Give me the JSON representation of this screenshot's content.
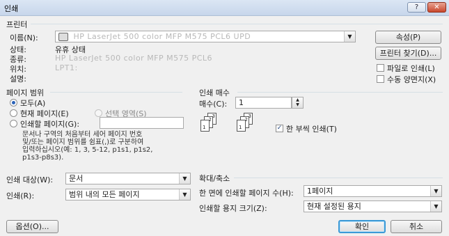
{
  "window": {
    "title": "인쇄",
    "help_label": "?",
    "close_label": "✕"
  },
  "printer": {
    "group_label": "프린터",
    "name_label": "이름(N):",
    "name_value": "HP LaserJet 500 color MFP M575 PCL6 UPD",
    "status_label": "상태:",
    "status_value": "유휴 상태",
    "type_label": "종류:",
    "type_value": "HP LaserJet 500 color MFP M575 PCL6",
    "where_label": "위치:",
    "where_value": "LPT1:",
    "comment_label": "설명:",
    "properties_button": "속성(P)",
    "find_printer_button": "프린터 찾기(D)...",
    "print_to_file_label": "파일로 인쇄(L)",
    "manual_duplex_label": "수동 양면지(X)",
    "print_to_file_checked": false,
    "manual_duplex_checked": false
  },
  "page_range": {
    "group_label": "페이지 범위",
    "all_label": "모두(A)",
    "current_label": "현재 페이지(E)",
    "selection_label": "선택 영역(S)",
    "pages_label": "인쇄할 페이지(G):",
    "pages_value": "",
    "hint_lines": [
      "문서나 구역의 처음부터 세어 페이지 번호",
      "및/또는 페이지 범위를 쉼표(,)로 구분하여",
      "입력하십시오(예: 1, 3, 5-12, p1s1, p1s2,",
      "p1s3-p8s3)."
    ]
  },
  "copies": {
    "group_label": "인쇄 매수",
    "copies_label": "매수(C):",
    "copies_value": "1",
    "collate_label": "한 부씩 인쇄(T)",
    "collate_checked": true,
    "page_numbers": [
      "1",
      "2",
      "3"
    ]
  },
  "print_what": {
    "label": "인쇄 대상(W):",
    "value": "문서"
  },
  "print": {
    "label": "인쇄(R):",
    "value": "범위 내의 모든 페이지"
  },
  "zoom": {
    "group_label": "확대/축소",
    "pages_per_sheet_label": "한 면에 인쇄할 페이지 수(H):",
    "pages_per_sheet_value": "1페이지",
    "scale_label": "인쇄할 용지 크기(Z):",
    "scale_value": "현재 설정된 용지"
  },
  "footer": {
    "options_button": "옵션(O)...",
    "ok_button": "확인",
    "cancel_button": "취소"
  },
  "icons": {
    "printer": "printer-icon",
    "dropdown": "chevron-down-icon",
    "spin": "spinner-icon"
  }
}
